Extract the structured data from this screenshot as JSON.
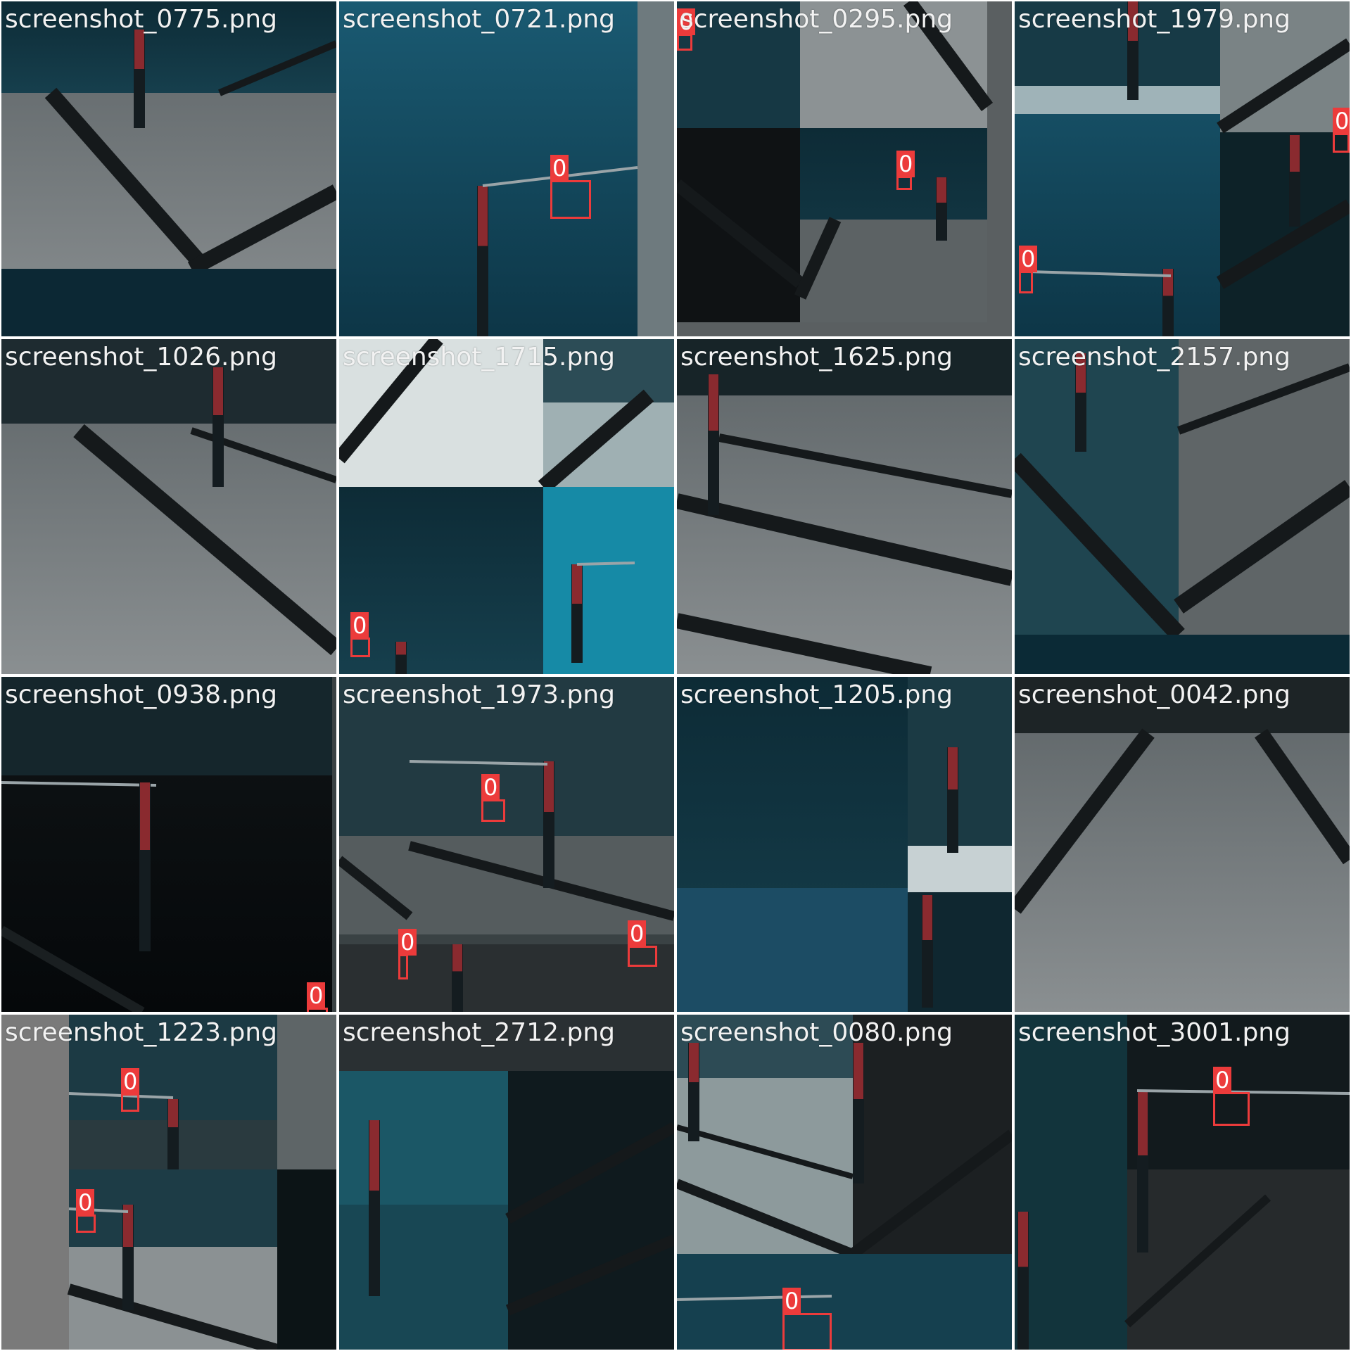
{
  "grid": {
    "columns": 4,
    "rows": 4
  },
  "box_color": "#ec3b3b",
  "tiles": [
    {
      "filename": "screenshot_0775.png",
      "detections": []
    },
    {
      "filename": "screenshot_0721.png",
      "detections": [
        {
          "class": "0"
        }
      ]
    },
    {
      "filename": "screenshot_0295.png",
      "detections": [
        {
          "class": "0"
        },
        {
          "class": "0"
        }
      ]
    },
    {
      "filename": "screenshot_1979.png",
      "detections": [
        {
          "class": "0"
        },
        {
          "class": "0"
        }
      ]
    },
    {
      "filename": "screenshot_1026.png",
      "detections": []
    },
    {
      "filename": "screenshot_1715.png",
      "detections": [
        {
          "class": "0"
        }
      ]
    },
    {
      "filename": "screenshot_1625.png",
      "detections": []
    },
    {
      "filename": "screenshot_2157.png",
      "detections": []
    },
    {
      "filename": "screenshot_0938.png",
      "detections": [
        {
          "class": "0"
        }
      ]
    },
    {
      "filename": "screenshot_1973.png",
      "detections": [
        {
          "class": "0"
        },
        {
          "class": "0"
        },
        {
          "class": "0"
        }
      ]
    },
    {
      "filename": "screenshot_1205.png",
      "detections": []
    },
    {
      "filename": "screenshot_0042.png",
      "detections": []
    },
    {
      "filename": "screenshot_1223.png",
      "detections": [
        {
          "class": "0"
        },
        {
          "class": "0"
        }
      ]
    },
    {
      "filename": "screenshot_2712.png",
      "detections": []
    },
    {
      "filename": "screenshot_0080.png",
      "detections": [
        {
          "class": "0"
        }
      ]
    },
    {
      "filename": "screenshot_3001.png",
      "detections": [
        {
          "class": "0"
        }
      ]
    }
  ]
}
